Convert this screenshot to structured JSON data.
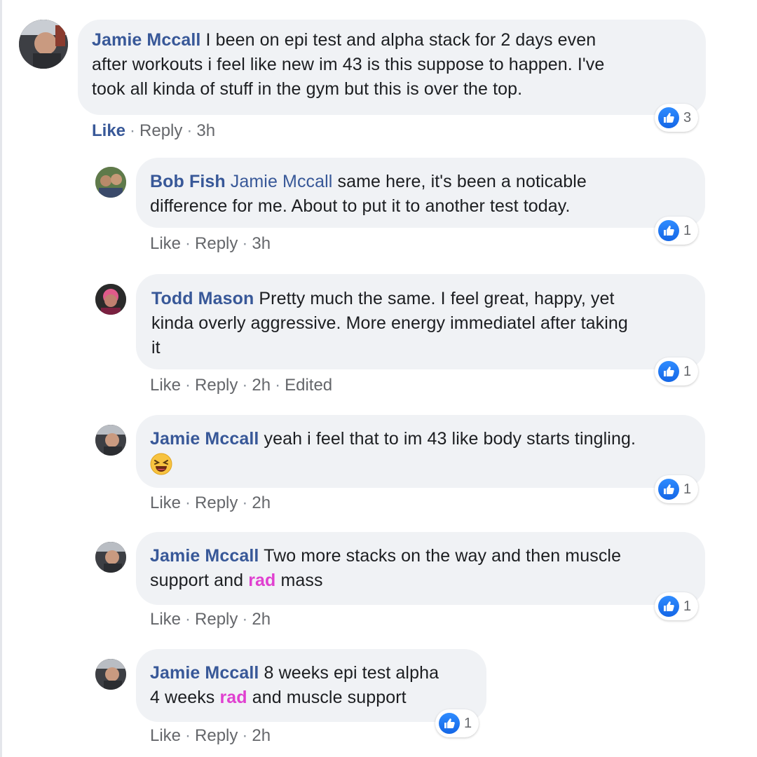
{
  "comments": [
    {
      "author": "Jamie Mccall",
      "text": "I been on epi test and alpha stack for 2 days even after workouts i feel like new im 43 is this suppose to happen. I've took all kinda of stuff in the gym but this is over the top.",
      "line1": "I been on epi test and alpha stack for 2 days even",
      "line2": "after workouts i feel like new im 43 is this suppose to happen. I've",
      "line3": "took all kinda of stuff in the gym but this is over the top.",
      "reactions": "3",
      "like": "Like",
      "reply": "Reply",
      "time": "3h"
    }
  ],
  "replies": [
    {
      "author": "Bob Fish",
      "mention": "Jamie Mccall",
      "line1": "same here, it's been a noticable",
      "line2": "difference for me. About to put it to another test today.",
      "reactions": "1",
      "like": "Like",
      "reply": "Reply",
      "time": "3h"
    },
    {
      "author": "Todd Mason",
      "line1": "Pretty much the same. I feel great, happy, yet",
      "line2": "kinda overly aggressive. More energy immediatel after taking",
      "line3": "it",
      "reactions": "1",
      "like": "Like",
      "reply": "Reply",
      "time": "2h",
      "edited": "Edited"
    },
    {
      "author": "Jamie Mccall",
      "line1": "yeah i feel that to im 43 like body starts tingling.",
      "emoji": "laughing-face",
      "reactions": "1",
      "like": "Like",
      "reply": "Reply",
      "time": "2h"
    },
    {
      "author": "Jamie Mccall",
      "line1": "Two more stacks on the way and then muscle",
      "line2a": "support and",
      "tag": "rad",
      "line2b": "mass",
      "reactions": "1",
      "like": "Like",
      "reply": "Reply",
      "time": "2h"
    },
    {
      "author": "Jamie Mccall",
      "line1": "8 weeks epi test alpha",
      "line2a": "4 weeks",
      "tag": "rad",
      "line2b": "and muscle support",
      "reactions": "1",
      "like": "Like",
      "reply": "Reply",
      "time": "2h"
    }
  ],
  "colors": {
    "author": "#385898",
    "bubble": "#f0f2f5",
    "like_blue": "#1877f2",
    "hashtag": "#e040d0",
    "meta": "#65676b"
  },
  "icons": [
    "avatar",
    "like-thumb-icon",
    "laughing-emoji-icon"
  ]
}
